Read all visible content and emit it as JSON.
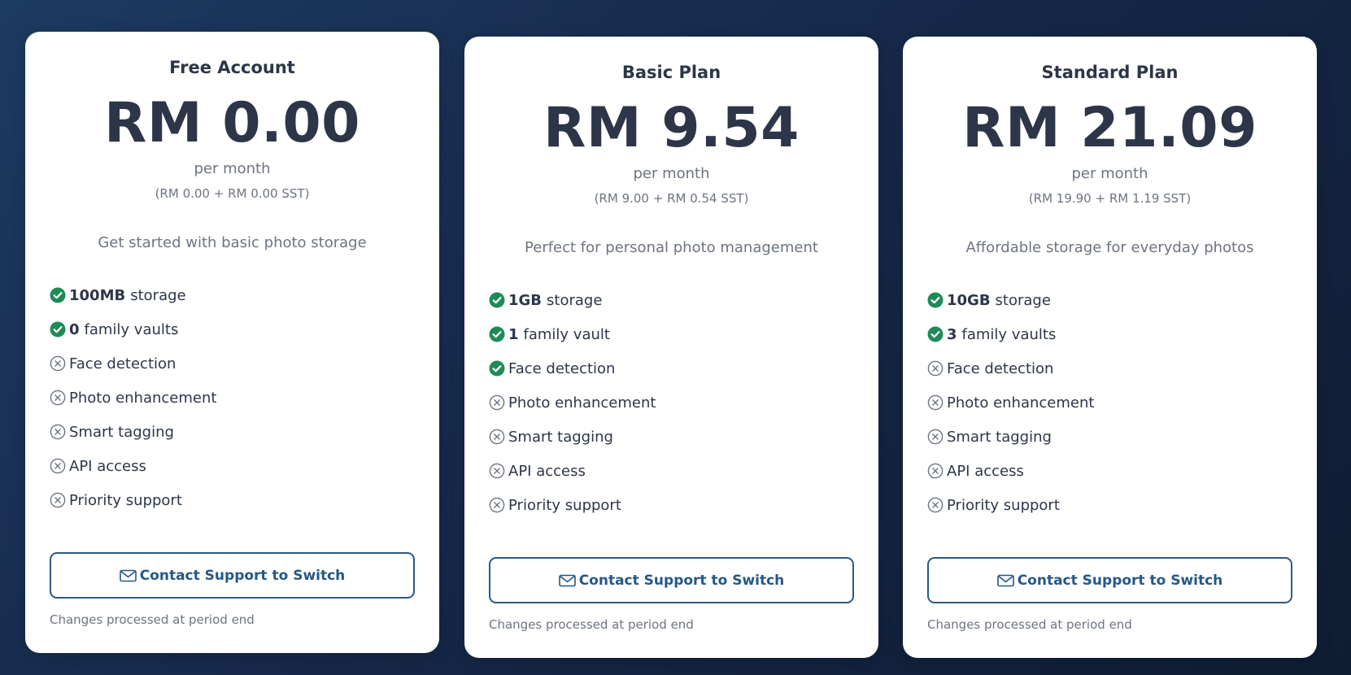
{
  "colors": {
    "check": "#1e8b57",
    "cross": "#6d7480",
    "accent": "#245887",
    "text": "#2d3648",
    "muted": "#6d7480"
  },
  "plans": [
    {
      "name": "Free Account",
      "price": "RM 0.00",
      "period": "per month",
      "breakdown": "(RM 0.00 + RM 0.00 SST)",
      "description": "Get started with basic photo storage",
      "features": [
        {
          "bold": "100MB",
          "text": "storage",
          "included": true,
          "icon": "check-circle-icon"
        },
        {
          "bold": "0",
          "text": "family vaults",
          "included": true,
          "icon": "check-circle-icon"
        },
        {
          "bold": "",
          "text": "Face detection",
          "included": false,
          "icon": "x-circle-icon"
        },
        {
          "bold": "",
          "text": "Photo enhancement",
          "included": false,
          "icon": "x-circle-icon"
        },
        {
          "bold": "",
          "text": "Smart tagging",
          "included": false,
          "icon": "x-circle-icon"
        },
        {
          "bold": "",
          "text": "API access",
          "included": false,
          "icon": "x-circle-icon"
        },
        {
          "bold": "",
          "text": "Priority support",
          "included": false,
          "icon": "x-circle-icon"
        }
      ],
      "button_label": "Contact Support to Switch",
      "button_icon": "mail-icon",
      "footnote": "Changes processed at period end"
    },
    {
      "name": "Basic Plan",
      "price": "RM 9.54",
      "period": "per month",
      "breakdown": "(RM 9.00 + RM 0.54 SST)",
      "description": "Perfect for personal photo management",
      "features": [
        {
          "bold": "1GB",
          "text": "storage",
          "included": true,
          "icon": "check-circle-icon"
        },
        {
          "bold": "1",
          "text": "family vault",
          "included": true,
          "icon": "check-circle-icon"
        },
        {
          "bold": "",
          "text": "Face detection",
          "included": true,
          "icon": "check-circle-icon"
        },
        {
          "bold": "",
          "text": "Photo enhancement",
          "included": false,
          "icon": "x-circle-icon"
        },
        {
          "bold": "",
          "text": "Smart tagging",
          "included": false,
          "icon": "x-circle-icon"
        },
        {
          "bold": "",
          "text": "API access",
          "included": false,
          "icon": "x-circle-icon"
        },
        {
          "bold": "",
          "text": "Priority support",
          "included": false,
          "icon": "x-circle-icon"
        }
      ],
      "button_label": "Contact Support to Switch",
      "button_icon": "mail-icon",
      "footnote": "Changes processed at period end"
    },
    {
      "name": "Standard Plan",
      "price": "RM 21.09",
      "period": "per month",
      "breakdown": "(RM 19.90 + RM 1.19 SST)",
      "description": "Affordable storage for everyday photos",
      "features": [
        {
          "bold": "10GB",
          "text": "storage",
          "included": true,
          "icon": "check-circle-icon"
        },
        {
          "bold": "3",
          "text": "family vaults",
          "included": true,
          "icon": "check-circle-icon"
        },
        {
          "bold": "",
          "text": "Face detection",
          "included": false,
          "icon": "x-circle-icon"
        },
        {
          "bold": "",
          "text": "Photo enhancement",
          "included": false,
          "icon": "x-circle-icon"
        },
        {
          "bold": "",
          "text": "Smart tagging",
          "included": false,
          "icon": "x-circle-icon"
        },
        {
          "bold": "",
          "text": "API access",
          "included": false,
          "icon": "x-circle-icon"
        },
        {
          "bold": "",
          "text": "Priority support",
          "included": false,
          "icon": "x-circle-icon"
        }
      ],
      "button_label": "Contact Support to Switch",
      "button_icon": "mail-icon",
      "footnote": "Changes processed at period end"
    }
  ]
}
